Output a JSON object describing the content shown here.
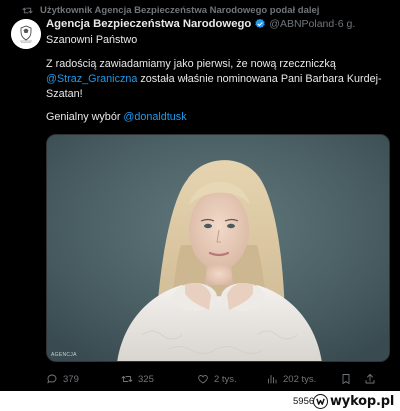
{
  "repost": {
    "text": "Użytkownik Agencja Bezpieczeństwa Narodowego podał dalej",
    "icon": "repost-icon"
  },
  "author": {
    "name": "Agencja Bezpieczeństwa Narodowego",
    "handle": "@ABNPoland",
    "separator": " · ",
    "time": "6 g.",
    "verified_color": "#1d9bf0"
  },
  "post": {
    "greeting": "Szanowni Państwo",
    "body_before": "Z radością zawiadamiamy jako pierwsi, że nową rzeczniczką",
    "mention_1": "@Straz_Graniczna",
    "body_after": " została właśnie nominowana Pani Barbara Kurdej-Szatan!",
    "closing_text": "Genialny wybór ",
    "mention_2": "@donaldtusk",
    "image_credit": "AGENCJA",
    "mention_color": "#1d9bf0"
  },
  "actions": {
    "replies": "379",
    "reposts": "325",
    "likes": "2 tys.",
    "views": "202 tys."
  },
  "footer": {
    "page_count": "5956 z",
    "site_name": "wykop.pl"
  }
}
